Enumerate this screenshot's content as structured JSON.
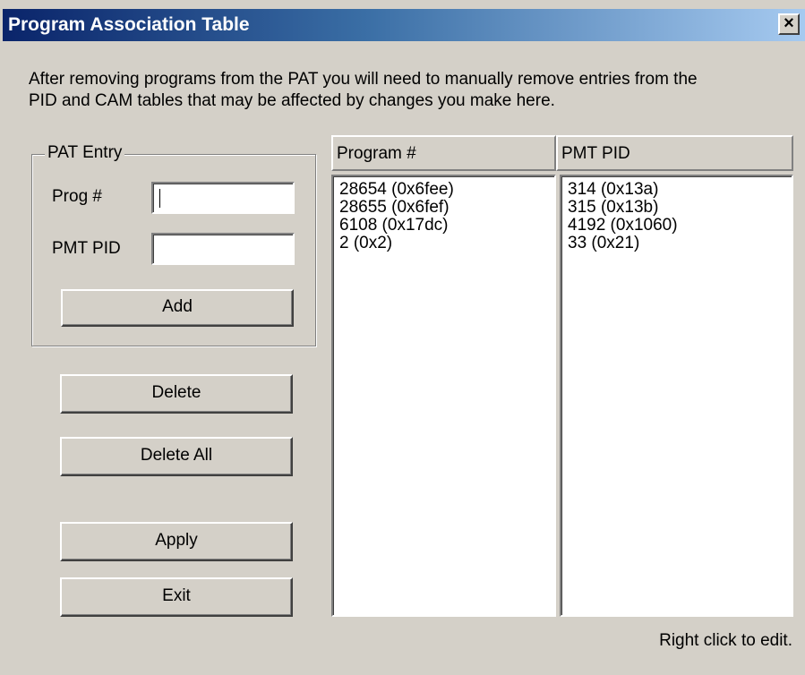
{
  "window": {
    "title": "Program Association Table",
    "close_label": "×"
  },
  "info": {
    "line1": "After removing programs from the PAT you will need to manually remove entries from the",
    "line2": "PID and CAM tables that may be affected by changes you make here."
  },
  "pat_entry": {
    "group_label": "PAT Entry",
    "prog_label": "Prog #",
    "prog_value": "",
    "pmt_label": "PMT PID",
    "pmt_value": "",
    "add_label": "Add"
  },
  "actions": {
    "delete_label": "Delete",
    "delete_all_label": "Delete All",
    "apply_label": "Apply",
    "exit_label": "Exit"
  },
  "table": {
    "columns": [
      "Program #",
      "PMT PID"
    ],
    "programs": [
      "28654 (0x6fee)",
      "28655 (0x6fef)",
      "6108 (0x17dc)",
      "2 (0x2)"
    ],
    "pmt_pids": [
      "314 (0x13a)",
      "315 (0x13b)",
      "4192 (0x1060)",
      "33 (0x21)"
    ]
  },
  "status": {
    "hint": "Right click to edit."
  }
}
